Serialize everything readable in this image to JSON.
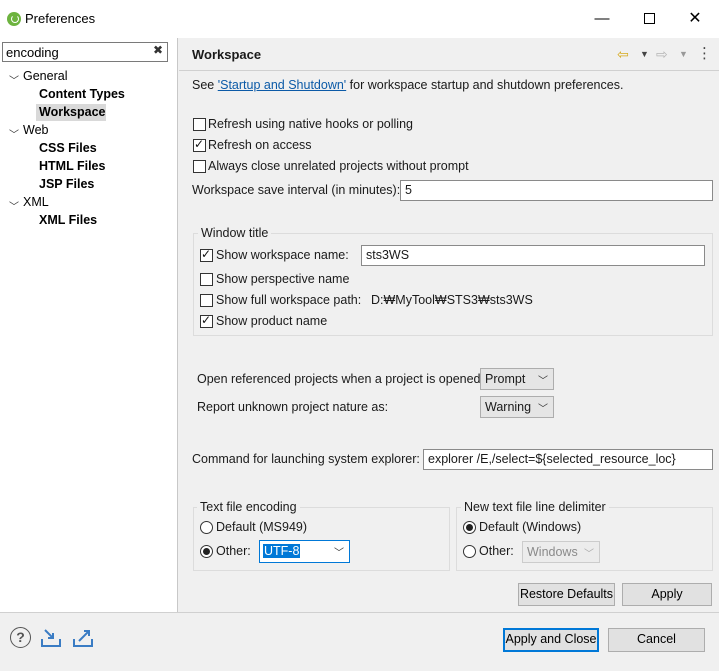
{
  "window": {
    "title": "Preferences",
    "minimize": "—",
    "close": "✕"
  },
  "sidebar": {
    "filter_value": "encoding",
    "filter_clear": "✖",
    "tree": [
      {
        "label": "General",
        "children": [
          "Content Types",
          "Workspace"
        ]
      },
      {
        "label": "Web",
        "children": [
          "CSS Files",
          "HTML Files",
          "JSP Files"
        ]
      },
      {
        "label": "XML",
        "children": [
          "XML Files"
        ]
      }
    ],
    "selected": "Workspace"
  },
  "page": {
    "title": "Workspace",
    "intro_prefix": "See ",
    "intro_link": "'Startup and Shutdown'",
    "intro_suffix": " for workspace startup and shutdown preferences.",
    "options": [
      {
        "label": "Refresh using native hooks or polling",
        "checked": false
      },
      {
        "label": "Refresh on access",
        "checked": true
      },
      {
        "label": "Always close unrelated projects without prompt",
        "checked": false
      }
    ],
    "save_interval_label": "Workspace save interval (in minutes):",
    "save_interval_value": "5",
    "window_title": {
      "group_label": "Window title",
      "show_workspace_name_label": "Show workspace name:",
      "show_workspace_name_checked": true,
      "workspace_name_value": "sts3WS",
      "show_perspective_label": "Show perspective name",
      "show_perspective_checked": false,
      "show_full_path_label": "Show full workspace path:",
      "show_full_path_checked": false,
      "full_path_value": "D:₩MyTool₩STS3₩sts3WS",
      "show_product_label": "Show product name",
      "show_product_checked": true
    },
    "open_referenced_label": "Open referenced projects when a project is opened:",
    "open_referenced_value": "Prompt",
    "report_unknown_label": "Report unknown project nature as:",
    "report_unknown_value": "Warning",
    "explorer_label": "Command for launching system explorer:",
    "explorer_value": "explorer /E,/select=${selected_resource_loc}",
    "encoding": {
      "group_label": "Text file encoding",
      "default_label": "Default (MS949)",
      "other_label": "Other:",
      "other_value": "UTF-8",
      "selected": "Other"
    },
    "line_delimiter": {
      "group_label": "New text file line delimiter",
      "default_label": "Default (Windows)",
      "other_label": "Other:",
      "other_value": "Windows",
      "selected": "Default"
    },
    "restore_defaults": "Restore Defaults",
    "apply": "Apply"
  },
  "footer": {
    "help": "?",
    "apply_and_close": "Apply and Close",
    "cancel": "Cancel"
  },
  "colors": {
    "accent": "#0078d7",
    "link": "#0b5aa7",
    "back_arrow": "#d6a91c"
  }
}
